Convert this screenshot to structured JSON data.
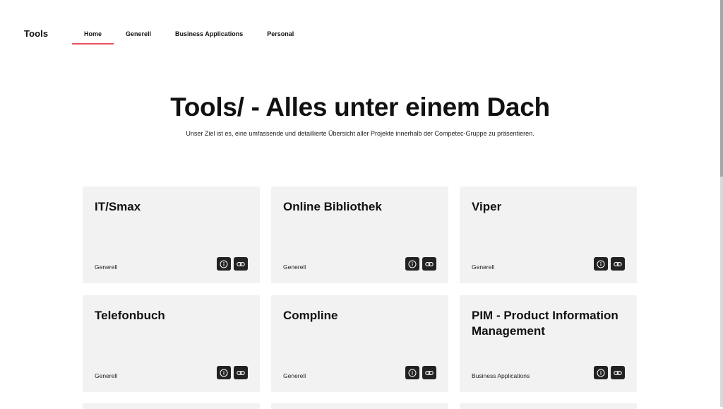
{
  "header": {
    "brand": "Tools",
    "nav": [
      {
        "label": "Home",
        "active": true
      },
      {
        "label": "Generell",
        "active": false
      },
      {
        "label": "Business Applications",
        "active": false
      },
      {
        "label": "Personal",
        "active": false
      }
    ]
  },
  "hero": {
    "title": "Tools/ - Alles unter einem Dach",
    "subtitle": "Unser Ziel ist es, eine umfassende und detaillierte Übersicht aller Projekte innerhalb der Competec-Gruppe zu präsentieren."
  },
  "cards": [
    {
      "title": "IT/Smax",
      "category": "Generell"
    },
    {
      "title": "Online Bibliothek",
      "category": "Generell"
    },
    {
      "title": "Viper",
      "category": "Generell"
    },
    {
      "title": "Telefonbuch",
      "category": "Generell"
    },
    {
      "title": "Compline",
      "category": "Generell"
    },
    {
      "title": "PIM - Product Information Management",
      "category": "Business Applications"
    }
  ],
  "card_actions": {
    "info_icon": "info-icon",
    "link_icon": "link-icon"
  },
  "colors": {
    "accent": "#e8505b",
    "card_bg": "#f2f2f2",
    "icon_button_bg": "#222222"
  }
}
